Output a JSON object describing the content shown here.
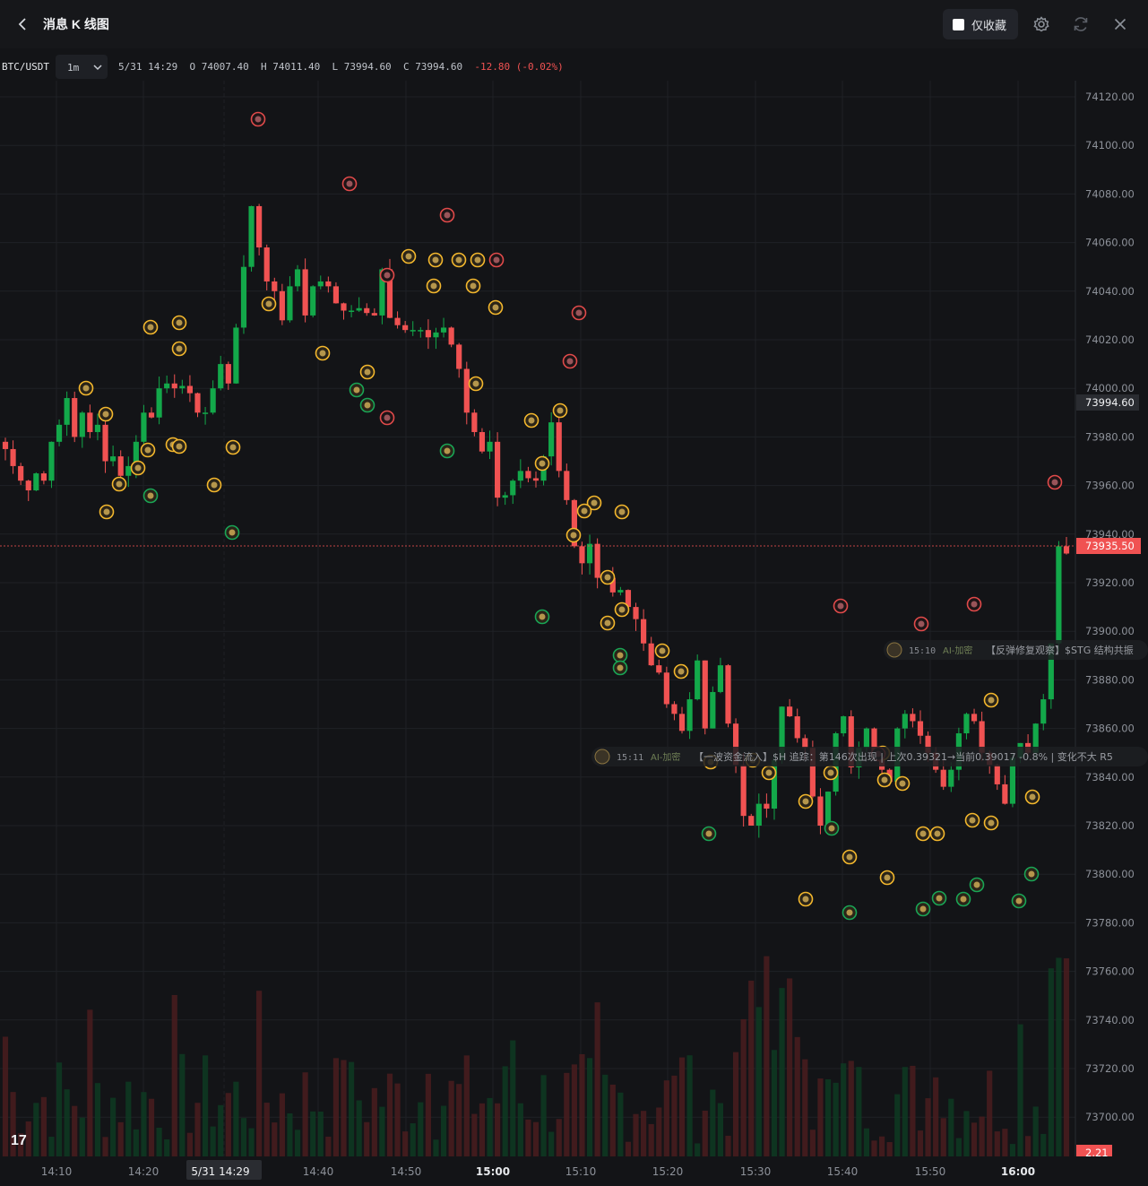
{
  "header": {
    "title": "消息 K 线图",
    "favorites_label": "仅收藏"
  },
  "symbol_bar": {
    "symbol": "BTC/USDT",
    "interval": "1m",
    "datetime": "5/31 14:29",
    "open_label": "O",
    "open": "74007.40",
    "high_label": "H",
    "high": "74011.40",
    "low_label": "L",
    "low": "73994.60",
    "close_label": "C",
    "close": "73994.60",
    "change": "-12.80",
    "change_pct": "(-0.02%)"
  },
  "colors": {
    "up": "#13a84a",
    "down": "#f05252",
    "accent": "#f3b72d"
  },
  "price_axis": {
    "labels": [
      "74120.00",
      "74100.00",
      "74080.00",
      "74060.00",
      "74040.00",
      "74020.00",
      "74000.00",
      "73980.00",
      "73960.00",
      "73940.00",
      "73920.00",
      "73900.00",
      "73880.00",
      "73860.00",
      "73840.00",
      "73820.00",
      "73800.00",
      "73780.00",
      "73760.00",
      "73740.00",
      "73720.00",
      "73700.00"
    ],
    "crosshair_price": "73994.60",
    "last_price": "73935.50",
    "volume_value": "2.21"
  },
  "time_axis": {
    "labels": [
      "14:10",
      "14:20",
      "5/31 14:29",
      "14:40",
      "14:50",
      "15:00",
      "15:10",
      "15:20",
      "15:30",
      "15:40",
      "15:50",
      "16:00"
    ]
  },
  "news_labels": [
    {
      "time": "15:10",
      "tag": "AI-加密",
      "text": "【反弹修复观察】$STG 结构共振"
    },
    {
      "time": "15:11",
      "tag": "AI-加密",
      "text": "【一波资金流入】$H 追踪：第146次出现 | 上次0.39321→当前0.39017 -0.8% | 变化不大 R5"
    }
  ],
  "chart_data": {
    "type": "candlestick",
    "symbol": "BTC/USDT",
    "interval": "1m",
    "ylim": [
      73693,
      74123
    ],
    "x": [
      "14:10",
      "14:20",
      "14:29",
      "14:40",
      "14:50",
      "15:00",
      "15:10",
      "15:20",
      "15:30",
      "15:40",
      "15:50",
      "16:00"
    ],
    "candles_close": [
      73975,
      73968,
      73962,
      73958,
      73965,
      73962,
      73978,
      73985,
      73996,
      73980,
      73990,
      73982,
      73985,
      73970,
      73972,
      73964,
      73968,
      73978,
      73990,
      73988,
      74000,
      74002,
      74000,
      74001,
      73998,
      73990,
      73990,
      74000,
      74010,
      74002,
      74025,
      74050,
      74075,
      74058,
      74044,
      74040,
      74028,
      74042,
      74049,
      74030,
      74042,
      74044,
      74042,
      74035,
      74032,
      74032,
      74033,
      74031,
      74030,
      74049,
      74029,
      74026,
      74024,
      74024,
      74024,
      74021,
      74023,
      74025,
      74018,
      74008,
      73990,
      73982,
      73974,
      73978,
      73955,
      73956,
      73962,
      73966,
      73963,
      73962,
      73972,
      73986,
      73966,
      73954,
      73935,
      73928,
      73936,
      73922,
      73922,
      73916,
      73917,
      73910,
      73905,
      73895,
      73886,
      73883,
      73870,
      73866,
      73859,
      73872,
      73888,
      73860,
      73875,
      73886,
      73862,
      73845,
      73824,
      73820,
      73829,
      73827,
      73847,
      73869,
      73865,
      73856,
      73852,
      73832,
      73820,
      73834,
      73858,
      73865,
      73844,
      73852,
      73860,
      73850,
      73843,
      73838,
      73860,
      73866,
      73863,
      73857,
      73850,
      73843,
      73836,
      73843,
      73858,
      73866,
      73863,
      73850,
      73845,
      73837,
      73829,
      73848,
      73854,
      73850,
      73862,
      73872,
      73895,
      73935,
      73932
    ],
    "volume_max": 2.21
  }
}
